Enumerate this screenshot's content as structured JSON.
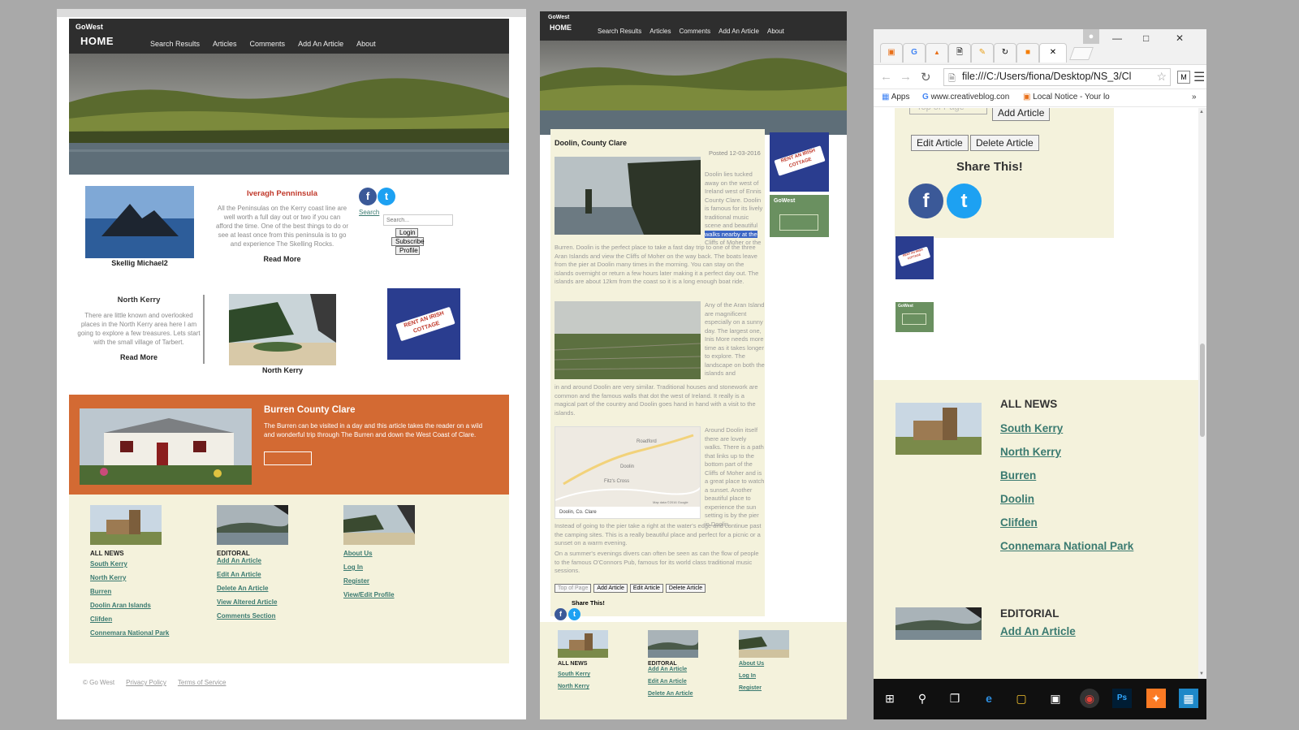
{
  "site": {
    "brand_small": "GoWest",
    "brand_home": "HOME",
    "nav": [
      "Search Results",
      "Articles",
      "Comments",
      "Add An Article",
      "About"
    ]
  },
  "home": {
    "cards": {
      "skellig_caption": "Skellig Michael2",
      "iveragh_title": "Iveragh Penninsula",
      "iveragh_text": "All the Peninsulas on the Kerry coast line are well worth a full day out or two if you can afford the time. One of the best things to do or see at least once from this peninsula is to go and experience The Skelling Rocks.",
      "read_more": "Read More",
      "north_kerry_title": "North Kerry",
      "north_kerry_text": "There are little known and overlooked places in the North Kerry area here I am going to explore a few treasures. Lets start with the small village of Tarbert.",
      "north_kerry_caption": "North Kerry"
    },
    "sidebar": {
      "search_link": "Search",
      "search_placeholder": "Search...",
      "buttons": [
        "Login",
        "Subscribe",
        "Profile"
      ]
    },
    "rent_sign": "RENT AN IRISH COTTAGE",
    "feature": {
      "title": "Burren County Clare",
      "text": "The Burren can be visited in a day and this article takes the reader on a wild and wonderful trip through The Burren and down the West Coast of Clare."
    },
    "footer": {
      "col1_head": "ALL NEWS",
      "col1_links": [
        "South Kerry",
        "North Kerry",
        "Burren",
        "Doolin Aran Islands",
        "Clifden",
        "Connemara National Park"
      ],
      "col2_head": "EDITORAL",
      "col2_links": [
        "Add An Article",
        "Edit An Article",
        "Delete An Article",
        "View Altered Article",
        "Comments Section"
      ],
      "col3_links": [
        "About Us",
        "Log In",
        "Register",
        "View/Edit Profile"
      ]
    },
    "legal": [
      "© Go West",
      "Privacy Policy",
      "Terms of Service"
    ]
  },
  "article": {
    "title": "Doolin, County Clare",
    "posted": "Posted 12-03-2016",
    "p1_side": "Doolin lies tucked away on the west of Ireland west of Ennis County Clare. Doolin is famous for its lively traditional music scene and beautiful",
    "p1_highlight": "walks nearby at the",
    "p1_side_end": "Cliffs of Moher or the",
    "p1_full": "Burren. Doolin is the perfect place to take a fast day trip to one of the three Aran Islands and view the Cliffs of Moher on the way back. The boats leave from the pier at Doolin many times in the morning. You can stay on the islands overnight or return a few hours later making it a perfect day out. The islands are about 12km from the coast so it is a long enough boat ride.",
    "p2_side": "Any of the Aran Island are magnificent especially on a sunny day. The largest one, Inis More needs more time as it takes longer to explore. The landscape on both the islands and",
    "p2_full": "in and around Doolin are very similar. Traditional houses and stonework are common and the famous walls that dot the west of Ireland. It really is a magical part of the country and Doolin goes hand in hand with a visit to the islands.",
    "p3_side": "Around Doolin itself there are lovely walks. There is a path that links up to the bottom part of the Cliffs of Moher and is a great place to watch a sunset. Another beautiful place to experience the sun setting is by the pier in Doolin.",
    "p3_full": "Instead of going to the pier take a right at the water's edge and continue past the camping sites. This is a really beautiful place and perfect for a picnic or a sunset on a warm evening.",
    "p4_full": "On a summer's evenings divers can often be seen as can the flow of people to the famous O'Connors Pub, famous for its world class traditional music sessions.",
    "map_caption": "Doolin, Co. Clare",
    "map_labels": [
      "Roadford",
      "Doolin",
      "Fitz's Cross"
    ],
    "map_credit": "Map data ©2016 Google",
    "buttons": [
      "Top of Page",
      "Add Article",
      "Edit Article",
      "Delete Article"
    ],
    "share": "Share This!",
    "side_green_label": "GoWest",
    "footer_links_col1": [
      "South Kerry",
      "North Kerry"
    ],
    "footer_links_col2": [
      "Add An Article",
      "Edit An Article",
      "Delete An Article"
    ],
    "footer_links_col3": [
      "About Us",
      "Log In",
      "Register"
    ]
  },
  "browser": {
    "url": "file:///C:/Users/fiona/Desktop/NS_3/Cl",
    "bookmarks": [
      "Apps",
      "www.creativeblog.con",
      "Local Notice - Your lo"
    ],
    "partial_top_btn": "Top of Page",
    "add_btn": "Add Article",
    "edit_btn": "Edit Article",
    "delete_btn": "Delete Article",
    "share": "Share This!",
    "all_news": "ALL NEWS",
    "links": [
      "South Kerry",
      "North Kerry",
      "Burren",
      "Doolin",
      "Clifden",
      "Connemara National Park"
    ],
    "editorial": "EDITORIAL",
    "editorial_link": "Add An Article"
  },
  "colors": {
    "nav_bg": "#2e2e2e",
    "feature_orange": "#d36a33",
    "footer_cream": "#f4f2dc",
    "link_teal": "#3a7a70",
    "facebook": "#3b5998",
    "twitter": "#1da1f2",
    "rent_blue": "#2a3d8f"
  }
}
